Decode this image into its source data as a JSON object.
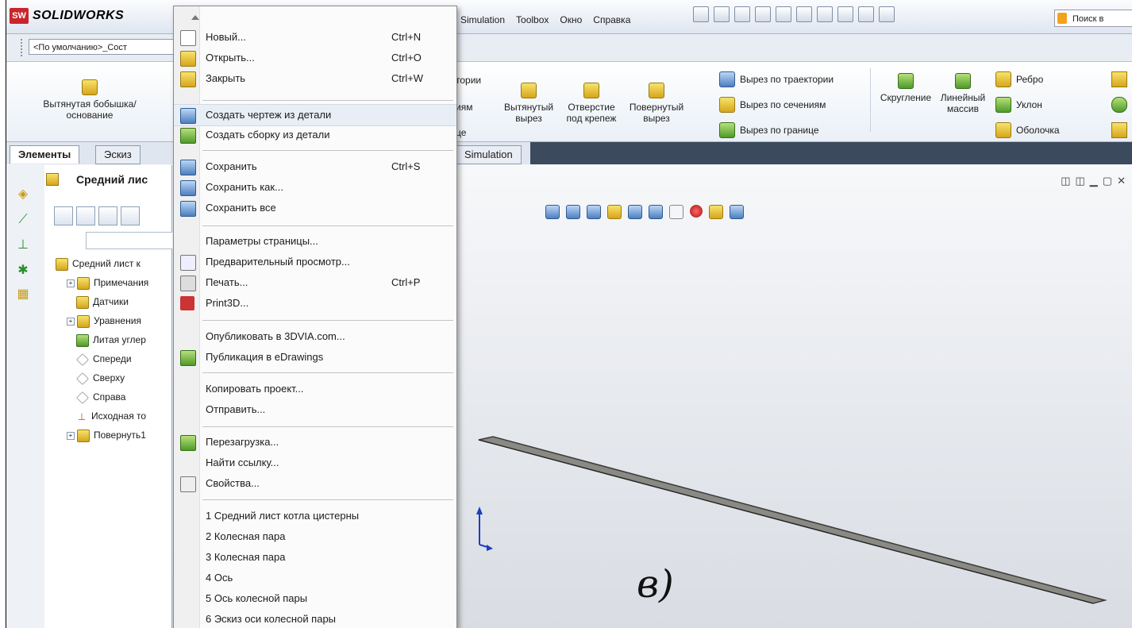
{
  "app": {
    "name": "SOLIDWORKS",
    "badge": "SW"
  },
  "menubar": [
    "Simulation",
    "Toolbox",
    "Окно",
    "Справка"
  ],
  "quick_toolbar": {
    "search_placeholder": "Поиск в"
  },
  "config": {
    "value": "<По умолчанию>_Сост"
  },
  "ribbon": {
    "extrude_boss": "Вытянутая бобышка/основание",
    "cut_partial1": "тории",
    "cut_partial2": "иям",
    "cut_partial3": "це",
    "extrude_cut": "Вытянутый вырез",
    "hole": "Отверстие под крепеж",
    "revolve_cut": "Повернутый вырез",
    "sweep_cut": "Вырез по траектории",
    "loft_cut": "Вырез по сечениям",
    "boundary_cut": "Вырез по границе",
    "fillet": "Скругление",
    "linear_pattern": "Линейный массив",
    "rib": "Ребро",
    "draft": "Уклон",
    "shell": "Оболочка"
  },
  "tabs": [
    "Элементы",
    "Эскиз",
    "Simulation"
  ],
  "panel": {
    "title": "Средний лис",
    "tree": [
      "Средний лист к",
      "Примечания",
      "Датчики",
      "Уравнения",
      "Литая углер",
      "Спереди",
      "Сверху",
      "Справа",
      "Исходная то",
      "Повернуть1"
    ]
  },
  "menu": {
    "items": [
      {
        "label": "Новый...",
        "shortcut": "Ctrl+N"
      },
      {
        "label": "Открыть...",
        "shortcut": "Ctrl+O"
      },
      {
        "label": "Закрыть",
        "shortcut": "Ctrl+W"
      },
      {
        "label": "Создать чертеж из детали",
        "shortcut": ""
      },
      {
        "label": "Создать сборку из детали",
        "shortcut": ""
      },
      {
        "label": "Сохранить",
        "shortcut": "Ctrl+S"
      },
      {
        "label": "Сохранить как...",
        "shortcut": ""
      },
      {
        "label": "Сохранить все",
        "shortcut": ""
      },
      {
        "label": "Параметры страницы...",
        "shortcut": ""
      },
      {
        "label": "Предварительный просмотр...",
        "shortcut": ""
      },
      {
        "label": "Печать...",
        "shortcut": "Ctrl+P"
      },
      {
        "label": "Print3D...",
        "shortcut": ""
      },
      {
        "label": "Опубликовать в 3DVIA.com...",
        "shortcut": ""
      },
      {
        "label": "Публикация в eDrawings",
        "shortcut": ""
      },
      {
        "label": "Копировать проект...",
        "shortcut": ""
      },
      {
        "label": "Отправить...",
        "shortcut": ""
      },
      {
        "label": "Перезагрузка...",
        "shortcut": ""
      },
      {
        "label": "Найти ссылку...",
        "shortcut": ""
      },
      {
        "label": "Свойства...",
        "shortcut": ""
      },
      {
        "label": "1 Средний лист котла цистерны",
        "shortcut": ""
      },
      {
        "label": "2 Колесная пара",
        "shortcut": ""
      },
      {
        "label": "3 Колесная пара",
        "shortcut": ""
      },
      {
        "label": "4 Ось",
        "shortcut": ""
      },
      {
        "label": "5 Ось колесной пары",
        "shortcut": ""
      },
      {
        "label": "6 Эскиз оси колесной пары",
        "shortcut": ""
      }
    ]
  },
  "annotation": "в)"
}
